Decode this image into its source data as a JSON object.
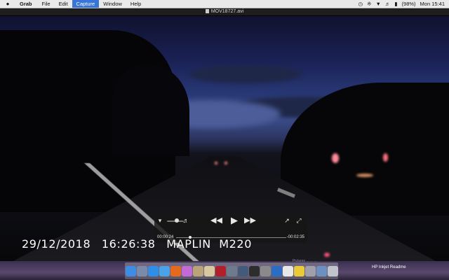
{
  "menubar": {
    "apple": "",
    "app_name": "Grab",
    "menus": [
      "File",
      "Edit",
      "Capture",
      "Window",
      "Help"
    ],
    "active_menu": "Capture",
    "battery": "(98%)",
    "clock": "Mon 15:41"
  },
  "window": {
    "title": "MOV18727.avi"
  },
  "video": {
    "timestamp_date": "29/12/2018",
    "timestamp_time": "16:26:38",
    "timestamp_device": "MAPLIN  M220"
  },
  "controller": {
    "elapsed": "00:00:24",
    "remaining": "-00:02:35",
    "progress": 0.13,
    "volume": 0.6
  },
  "dock": {
    "hover_label": "HP Inkjet Readme",
    "faint_label": "Pictures    ... ... ...",
    "icons": [
      {
        "name": "finder-icon",
        "color": "#3c8de3"
      },
      {
        "name": "launchpad-icon",
        "color": "#7a8aa8"
      },
      {
        "name": "app-store-icon",
        "color": "#2f8fe8"
      },
      {
        "name": "safari-icon",
        "color": "#4aa3e8"
      },
      {
        "name": "firefox-icon",
        "color": "#e66a1e"
      },
      {
        "name": "itunes-icon",
        "color": "#c46ad6"
      },
      {
        "name": "game-center-icon",
        "color": "#b9a47a"
      },
      {
        "name": "preview-icon",
        "color": "#d8c8a0"
      },
      {
        "name": "photo-booth-icon",
        "color": "#b21f2a"
      },
      {
        "name": "grab-icon",
        "color": "#6e7b8c"
      },
      {
        "name": "mission-control-icon",
        "color": "#445a7a"
      },
      {
        "name": "terminal-icon",
        "color": "#2d2d2d"
      },
      {
        "name": "system-preferences-icon",
        "color": "#8a8a8a"
      },
      {
        "name": "quicktime-icon",
        "color": "#2b6cc4"
      },
      {
        "name": "textedit-icon",
        "color": "#e8e8e8"
      },
      {
        "name": "stickies-icon",
        "color": "#e9cb3a"
      },
      {
        "name": "documents-icon",
        "color": "#a0a0aa"
      },
      {
        "name": "downloads-icon",
        "color": "#6c90c0"
      },
      {
        "name": "trash-icon",
        "color": "#c0c4cc"
      }
    ]
  }
}
